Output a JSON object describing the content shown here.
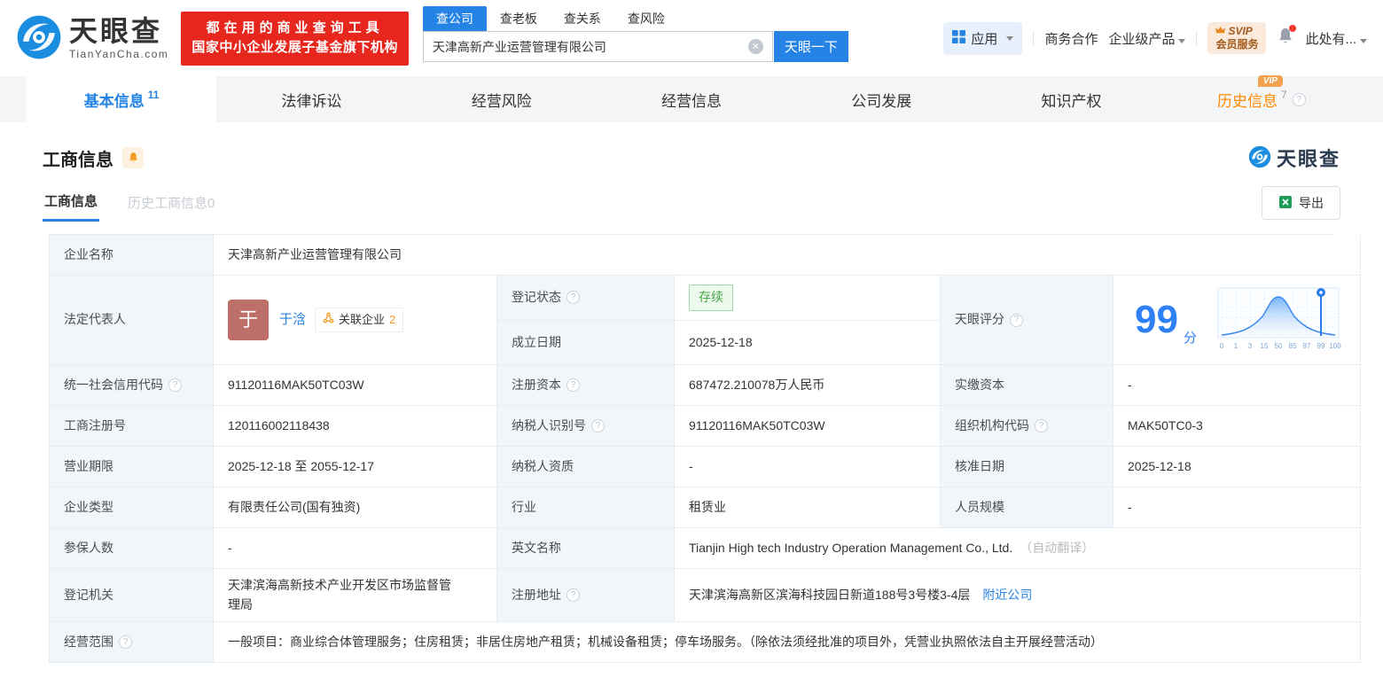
{
  "header": {
    "brand": "天眼查",
    "brand_domain": "TianYanCha.com",
    "promo_line1": "都在用的商业查询工具",
    "promo_line2": "国家中小企业发展子基金旗下机构",
    "search_tabs": [
      {
        "label": "查公司"
      },
      {
        "label": "查老板"
      },
      {
        "label": "查关系"
      },
      {
        "label": "查风险"
      }
    ],
    "search_value": "天津高新产业运营管理有限公司",
    "search_button": "天眼一下",
    "apps_label": "应用",
    "biz_coop": "商务合作",
    "enterprise_products": "企业级产品",
    "svip_top": "SVIP",
    "svip_bottom": "会员服务",
    "user_menu": "此处有..."
  },
  "nav_tabs": [
    {
      "label": "基本信息",
      "count": "11"
    },
    {
      "label": "法律诉讼"
    },
    {
      "label": "经营风险"
    },
    {
      "label": "经营信息"
    },
    {
      "label": "公司发展"
    },
    {
      "label": "知识产权"
    },
    {
      "label": "历史信息",
      "count": "7",
      "vip": "VIP"
    }
  ],
  "section": {
    "title": "工商信息",
    "watermark_brand": "天眼查",
    "subtab_active": "工商信息",
    "subtab_history": "历史工商信息0",
    "export_label": "导出"
  },
  "fields": {
    "name": {
      "label": "企业名称",
      "value": "天津高新产业运营管理有限公司"
    },
    "legal_rep": {
      "label": "法定代表人",
      "avatar_text": "于",
      "name": "于浛",
      "badge_label": "关联企业",
      "badge_count": "2"
    },
    "reg_status": {
      "label": "登记状态",
      "value": "存续"
    },
    "est_date": {
      "label": "成立日期",
      "value": "2025-12-18"
    },
    "score": {
      "label": "天眼评分",
      "value": "99",
      "unit": "分"
    },
    "credit_code": {
      "label": "统一社会信用代码",
      "value": "91120116MAK50TC03W"
    },
    "reg_capital": {
      "label": "注册资本",
      "value": "687472.210078万人民币"
    },
    "paid_capital": {
      "label": "实缴资本",
      "value": "-"
    },
    "reg_number": {
      "label": "工商注册号",
      "value": "120116002118438"
    },
    "taxpayer_id": {
      "label": "纳税人识别号",
      "value": "91120116MAK50TC03W"
    },
    "org_code": {
      "label": "组织机构代码",
      "value": "MAK50TC0-3"
    },
    "biz_term": {
      "label": "营业期限",
      "value": "2025-12-18 至 2055-12-17"
    },
    "taxpayer_quality": {
      "label": "纳税人资质",
      "value": "-"
    },
    "approval_date": {
      "label": "核准日期",
      "value": "2025-12-18"
    },
    "company_type": {
      "label": "企业类型",
      "value": "有限责任公司(国有独资)"
    },
    "industry": {
      "label": "行业",
      "value": "租赁业"
    },
    "staff_size": {
      "label": "人员规模",
      "value": "-"
    },
    "insured": {
      "label": "参保人数",
      "value": "-"
    },
    "english_name": {
      "label": "英文名称",
      "value": "Tianjin High tech Industry Operation Management Co., Ltd.",
      "note": "（自动翻译）"
    },
    "reg_authority": {
      "label": "登记机关",
      "value": "天津滨海高新技术产业开发区市场监督管理局"
    },
    "reg_address": {
      "label": "注册地址",
      "value": "天津滨海高新区滨海科技园日新道188号3号楼3-4层",
      "link": "附近公司"
    },
    "biz_scope": {
      "label": "经营范围",
      "value": "一般项目：商业综合体管理服务；住房租赁；非居住房地产租赁；机械设备租赁；停车场服务。（除依法须经批准的项目外，凭营业执照依法自主开展经营活动）"
    }
  },
  "chart_data": {
    "type": "area",
    "title": "天眼评分分布曲线",
    "x_tick_labels": [
      "0",
      "1",
      "3",
      "15",
      "50",
      "85",
      "97",
      "99",
      "100"
    ],
    "marker_value": 99,
    "shape": "bell curve distribution with pin marker at score 99"
  }
}
